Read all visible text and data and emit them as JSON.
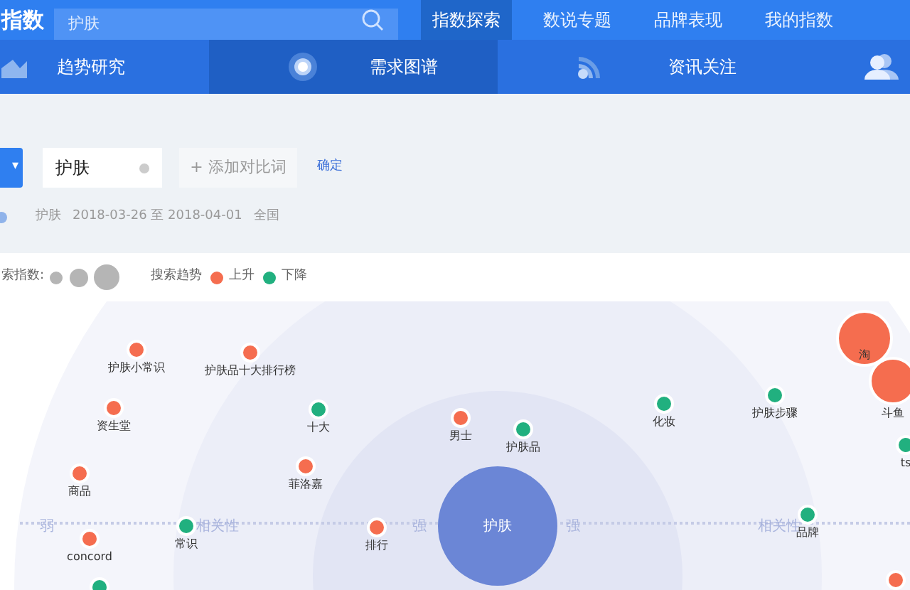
{
  "header": {
    "logo": "指数",
    "search": {
      "value": "护肤"
    },
    "nav": [
      {
        "label": "指数探索",
        "selected": true
      },
      {
        "label": "数说专题",
        "selected": false
      },
      {
        "label": "品牌表现",
        "selected": false
      },
      {
        "label": "我的指数",
        "selected": false
      }
    ]
  },
  "tabs": [
    {
      "label": "趋势研究",
      "selected": false
    },
    {
      "label": "需求图谱",
      "selected": true
    },
    {
      "label": "资讯关注",
      "selected": false
    }
  ],
  "query": {
    "dropdown_caret": "▾",
    "keyword": "护肤",
    "add_button": "+ 添加对比词",
    "confirm": "确定"
  },
  "info": {
    "keyword": "护肤",
    "dates": "2018-03-26 至 2018-04-01",
    "region": "全国"
  },
  "legend": {
    "index_label": "索指数:",
    "trend_label": "搜索趋势",
    "up": "上升",
    "down": "下降"
  },
  "graph": {
    "center": "护肤",
    "axis": [
      "弱",
      "相关性",
      "强",
      "强",
      "相关性"
    ],
    "nodes": [
      {
        "label": "护肤小常识",
        "color": "#f56d4f",
        "kind": "small"
      },
      {
        "label": "护肤品十大排行榜",
        "color": "#f56d4f",
        "kind": "small"
      },
      {
        "label": "资生堂",
        "color": "#f56d4f",
        "kind": "small"
      },
      {
        "label": "十大",
        "color": "#21b07f",
        "kind": "small"
      },
      {
        "label": "男士",
        "color": "#f56d4f",
        "kind": "small"
      },
      {
        "label": "护肤品",
        "color": "#21b07f",
        "kind": "small"
      },
      {
        "label": "化妆",
        "color": "#21b07f",
        "kind": "small"
      },
      {
        "label": "护肤步骤",
        "color": "#21b07f",
        "kind": "small"
      },
      {
        "label": "淘",
        "color": "#f56d4f",
        "kind": "large"
      },
      {
        "label": "斗鱼",
        "color": "#f56d4f",
        "kind": "large"
      },
      {
        "label": "ts",
        "color": "#21b07f",
        "kind": "small"
      },
      {
        "label": "商品",
        "color": "#f56d4f",
        "kind": "small"
      },
      {
        "label": "菲洛嘉",
        "color": "#f56d4f",
        "kind": "small"
      },
      {
        "label": "常识",
        "color": "#21b07f",
        "kind": "small"
      },
      {
        "label": "排行",
        "color": "#f56d4f",
        "kind": "small"
      },
      {
        "label": "品牌",
        "color": "#21b07f",
        "kind": "small"
      },
      {
        "label": "concord",
        "color": "#f56d4f",
        "kind": "small"
      },
      {
        "color": "#21b07f",
        "kind": "small"
      },
      {
        "color": "#f56d4f",
        "kind": "small"
      }
    ]
  }
}
